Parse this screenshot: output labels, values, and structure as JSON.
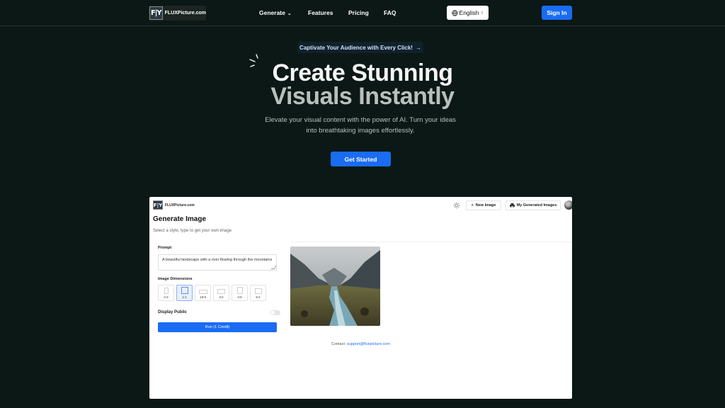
{
  "header": {
    "logo_mark": "F|Y",
    "logo_text": "FLUXPicture.com",
    "nav": [
      {
        "label": "Generate",
        "has_dropdown": true
      },
      {
        "label": "Features"
      },
      {
        "label": "Pricing"
      },
      {
        "label": "FAQ"
      }
    ],
    "language": "English",
    "signin_label": "Sign In"
  },
  "hero": {
    "pill": "Captivate Your Audience with Every Click!",
    "pill_arrow": "→",
    "title_line1": "Create Stunning",
    "title_line2": "Visuals Instantly",
    "subtitle_line1": "Elevate your visual content with the power of AI. Turn your ideas",
    "subtitle_line2": "into breathtaking images effortlessly.",
    "cta": "Get Started"
  },
  "app": {
    "logo_mark": "F|Y",
    "logo_text": "FLUXPicture.com",
    "new_image": "New Image",
    "my_images": "My Generated Images",
    "title": "Generate Image",
    "subtitle": "Select a style, type to get your own image",
    "prompt_label": "Prompt",
    "prompt_value": "A beautiful landscape with a river flowing through the mountains",
    "dimensions_label": "Image Dimensions",
    "dimensions": [
      {
        "label": "2:3",
        "selected": false
      },
      {
        "label": "1:1",
        "selected": true
      },
      {
        "label": "16:9",
        "selected": false
      },
      {
        "label": "3:2",
        "selected": false
      },
      {
        "label": "4:5",
        "selected": false
      },
      {
        "label": "5:4",
        "selected": false
      }
    ],
    "display_public_label": "Display Public",
    "run_label": "Run (1 Credit)",
    "contact_label": "Contact:",
    "contact_email": "support@fluxpicture.com"
  },
  "colors": {
    "background": "#0b1815",
    "accent": "#1a6cf3"
  }
}
